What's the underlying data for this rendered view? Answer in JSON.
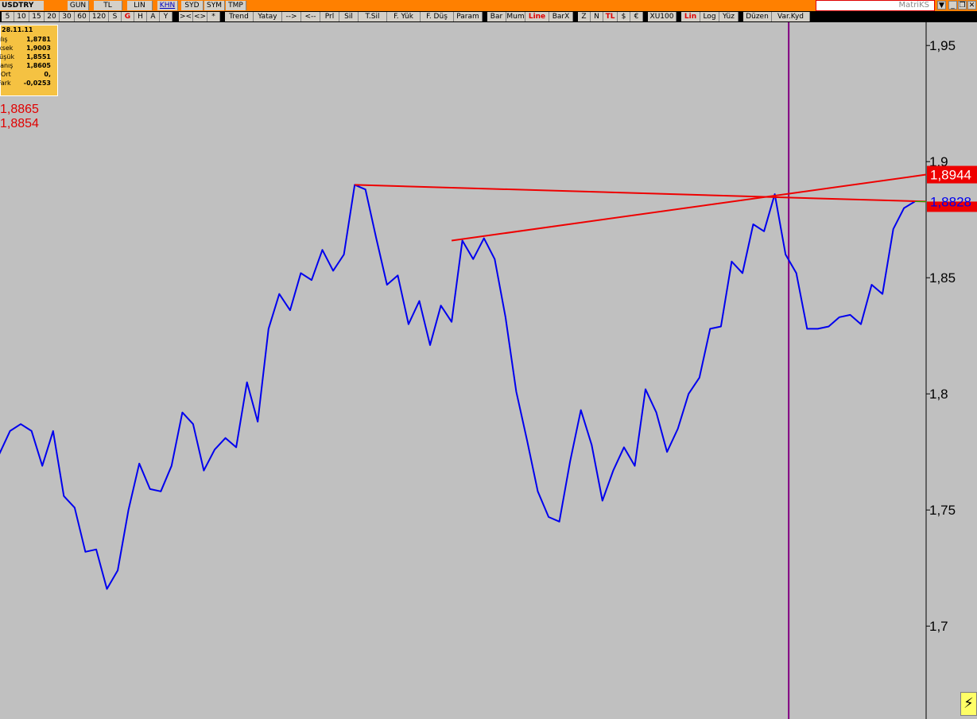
{
  "toolbar": {
    "symbol": "USDTRY",
    "row1": [
      "GUN",
      "TL",
      "LIN",
      "KHN",
      "SYD",
      "SYM",
      "TMP"
    ],
    "row2_periods": [
      "5",
      "10",
      "15",
      "20",
      "30",
      "60",
      "120",
      "S",
      "G",
      "H",
      "A",
      "Y"
    ],
    "row2_tools": [
      "><",
      "<>",
      "*",
      "Trend",
      "Yatay",
      "-->",
      "<--",
      "Prl",
      "Sil",
      "T.Sil",
      "F. Yük",
      "F. Düş",
      "Param",
      "Bar",
      "Mum",
      "Line",
      "BarX",
      "Z",
      "N",
      "TL",
      "$",
      "€",
      "XU100",
      "Lin",
      "Log",
      "Yüz",
      "Düzen",
      "Var.Kyd"
    ],
    "brand": "MatriKS"
  },
  "info_panel": {
    "date": "28.11.11",
    "rows": [
      {
        "label": "Açılış",
        "value": "1,8781"
      },
      {
        "label": "Yüksek",
        "value": "1,9003"
      },
      {
        "label": "Düşük",
        "value": "1,8551"
      },
      {
        "label": "Kapanış",
        "value": "1,8605"
      },
      {
        "label": "Ort",
        "value": "0,"
      },
      {
        "label": "Fark",
        "value": "-0,0253"
      }
    ]
  },
  "crosshair_values": [
    "1,8865",
    "1,8854"
  ],
  "colors": {
    "background": "#c0c0c0",
    "line": "#0000ee",
    "trend": "#ee0000",
    "cursor": "#800080"
  },
  "chart_data": {
    "type": "line",
    "title": "",
    "series": [
      {
        "values": [
          1.774,
          1.784,
          1.787,
          1.784,
          1.769,
          1.784,
          1.756,
          1.751,
          1.732,
          1.733,
          1.716,
          1.724,
          1.75,
          1.77,
          1.759,
          1.758,
          1.769,
          1.792,
          1.787,
          1.767,
          1.776,
          1.781,
          1.777,
          1.805,
          1.788,
          1.828,
          1.843,
          1.836,
          1.852,
          1.849,
          1.862,
          1.853,
          1.86,
          1.89,
          1.888,
          1.867,
          1.847,
          1.851,
          1.83,
          1.84,
          1.821,
          1.838,
          1.831,
          1.866,
          1.858,
          1.867,
          1.858,
          1.833,
          1.801,
          1.78,
          1.758,
          1.747,
          1.745,
          1.771,
          1.793,
          1.778,
          1.754,
          1.767,
          1.777,
          1.769,
          1.802,
          1.792,
          1.775,
          1.785,
          1.8,
          1.807,
          1.828,
          1.829,
          1.857,
          1.852,
          1.873,
          1.87,
          1.886,
          1.86,
          1.852,
          1.828,
          1.828,
          1.829,
          1.833,
          1.834,
          1.83,
          1.847,
          1.843,
          1.871,
          1.88,
          1.8828
        ]
      }
    ],
    "ylim": [
      1.66,
      1.96
    ],
    "y_ticks": [
      1.7,
      1.75,
      1.8,
      1.85,
      1.9,
      1.95
    ],
    "y_tick_labels": [
      "1,7",
      "1,75",
      "1,8",
      "1,85",
      "1,9",
      "1,95"
    ],
    "trendlines": [
      {
        "from_index": 33,
        "from_value": 1.89,
        "to_index": 86,
        "to_value": 1.8828
      },
      {
        "from_index": 42,
        "from_value": 1.866,
        "to_index": 86,
        "to_value": 1.8944
      }
    ],
    "cursor_index": 73,
    "last_value_labels": [
      {
        "text": "1,8944",
        "value": 1.8944,
        "style": "red"
      },
      {
        "text": "1,8828",
        "value": 1.8828,
        "style": "blue"
      }
    ],
    "grid": false
  }
}
